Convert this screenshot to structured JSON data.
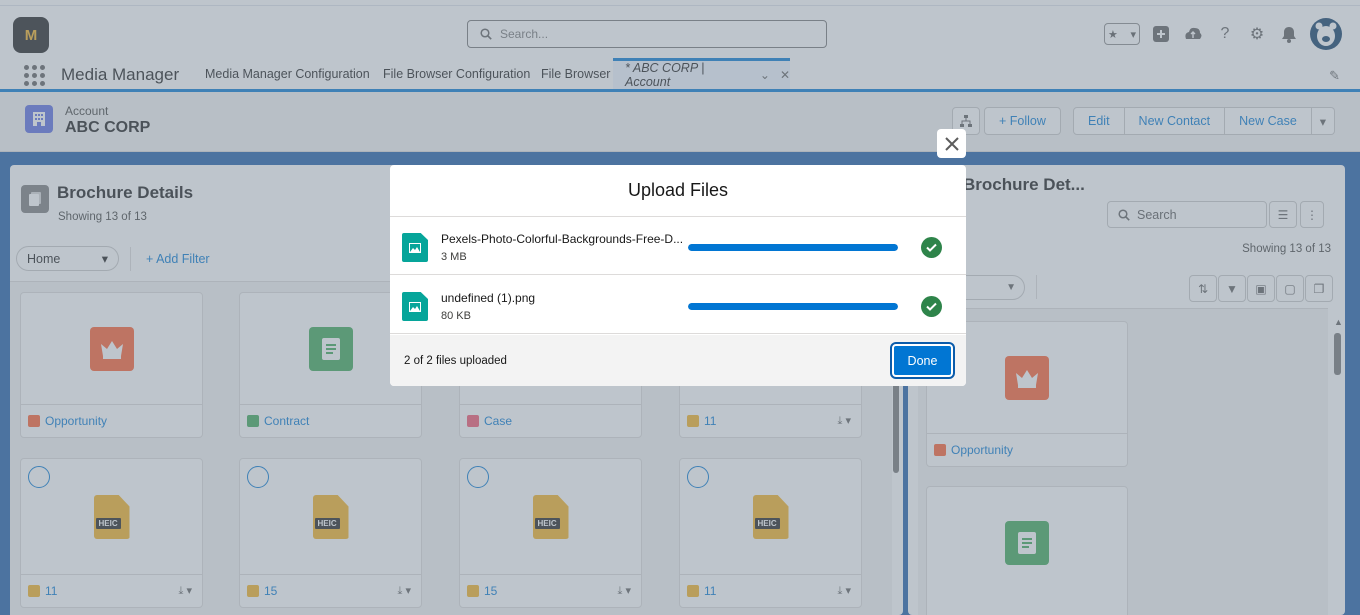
{
  "header": {
    "logo_text": "M",
    "search_placeholder": "Search..."
  },
  "nav": {
    "app_name": "Media Manager",
    "items": [
      "Media Manager Configuration",
      "File Browser Configuration",
      "File Browser"
    ],
    "active_tab": "* ABC CORP | Account"
  },
  "record": {
    "type": "Account",
    "name": "ABC CORP",
    "actions": {
      "follow": "+ Follow",
      "edit": "Edit",
      "new_contact": "New Contact",
      "new_case": "New Case"
    }
  },
  "left_card": {
    "title": "Brochure Details",
    "showing": "Showing 13 of 13",
    "home_select": "Home",
    "add_filter": "+ Add Filter",
    "tiles_row1": [
      {
        "label": "Opportunity",
        "kind": "opportunity"
      },
      {
        "label": "Contract",
        "kind": "contract"
      },
      {
        "label": "Case",
        "kind": "case"
      },
      {
        "label": "11",
        "kind": "heic"
      }
    ],
    "tiles_row2": [
      {
        "label": "11",
        "badge": "HEIC"
      },
      {
        "label": "15",
        "badge": "HEIC"
      },
      {
        "label": "15",
        "badge": "HEIC"
      },
      {
        "label": "11",
        "badge": "HEIC"
      }
    ]
  },
  "right_card": {
    "title": "Brochure Det...",
    "search_placeholder": "Search",
    "showing": "Showing 13 of 13",
    "tile1_label": "Opportunity"
  },
  "modal": {
    "title": "Upload Files",
    "files": [
      {
        "name": "Pexels-Photo-Colorful-Backgrounds-Free-D...",
        "size": "3 MB",
        "progress": 1.0
      },
      {
        "name": "undefined (1).png",
        "size": "80 KB",
        "progress": 1.0
      }
    ],
    "status": "2 of 2 files uploaded",
    "done_label": "Done"
  },
  "colors": {
    "brand": "#0176d3",
    "success": "#2e844a",
    "file_icon": "#06a59a"
  }
}
